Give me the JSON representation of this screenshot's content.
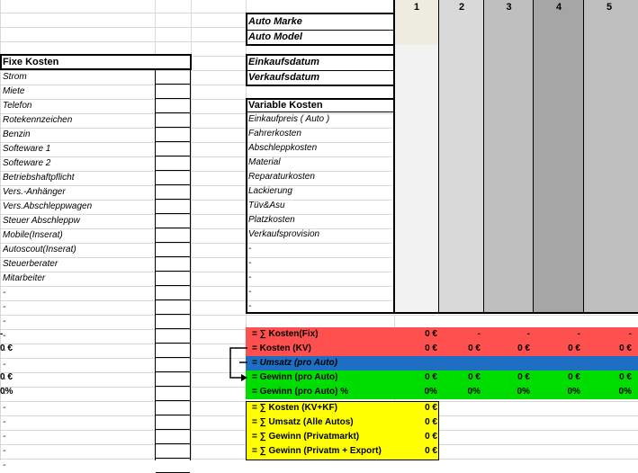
{
  "columns": [
    "1",
    "2",
    "3",
    "4",
    "5"
  ],
  "auto": {
    "marke_label": "Auto Marke",
    "model_label": "Auto Model",
    "einkauf_label": "Einkaufsdatum",
    "verkauf_label": "Verkaufsdatum"
  },
  "fixe_kosten": {
    "header": "Fixe Kosten",
    "items": [
      "Strom",
      "Miete",
      "Telefon",
      "Rotekennzeichen",
      "Benzin",
      "Softeware 1",
      "Softeware 2",
      "Betriebshaftpflicht",
      "Vers.-Anhänger",
      "Vers.Abschleppwagen",
      "Steuer Abschleppw",
      "Mobile(Inserat)",
      "Autoscout(Inserat)",
      "Steuerberater",
      "Mitarbeiter",
      "-",
      "-",
      "-",
      "-",
      "-",
      "-",
      "-",
      "-",
      "-",
      "-",
      "-",
      "-",
      "-"
    ]
  },
  "variable_kosten": {
    "header": "Variable Kosten",
    "items": [
      "Einkaufpreis ( Auto )",
      "Fahrerkosten",
      "Abschleppkosten",
      "Material",
      "Reparaturkosten",
      "Lackierung",
      "Tüv&Asu",
      "Platzkosten",
      "Verkaufsprovision",
      "-",
      "-",
      "-",
      "-",
      "-"
    ]
  },
  "summary": [
    {
      "label": "= ∑ Kosten(Fix)",
      "values": [
        "0 €",
        "-",
        "-",
        "-",
        "-",
        "-"
      ],
      "color": "#ff5050"
    },
    {
      "label": "= Kosten (KV)",
      "values": [
        "0 €",
        "0 €",
        "0 €",
        "0 €",
        "0 €",
        "0 €"
      ],
      "color": "#ff5050"
    },
    {
      "label": "= Umsatz (pro Auto)",
      "values": [
        "",
        "",
        "",
        "",
        "",
        ""
      ],
      "color": "#1e6fc4"
    },
    {
      "label": "= Gewinn (pro Auto)",
      "values": [
        "0 €",
        "0 €",
        "0 €",
        "0 €",
        "0 €",
        "0 €"
      ],
      "color": "#00dd00"
    },
    {
      "label": "= Gewinn (pro Auto) %",
      "values": [
        "0%",
        "0%",
        "0%",
        "0%",
        "0%",
        "0%"
      ],
      "color": "#00dd00"
    }
  ],
  "totals": {
    "color": "#ffff00",
    "rows": [
      {
        "label": "= ∑ Kosten (KV+KF)",
        "value": "0 €"
      },
      {
        "label": "= ∑ Umsatz (Alle Autos)",
        "value": "0 €"
      },
      {
        "label": "= ∑ Gewinn (Privatmarkt)",
        "value": "0 €"
      },
      {
        "label": "= ∑ Gewinn (Privatm + Export)",
        "value": "0 €"
      }
    ]
  }
}
